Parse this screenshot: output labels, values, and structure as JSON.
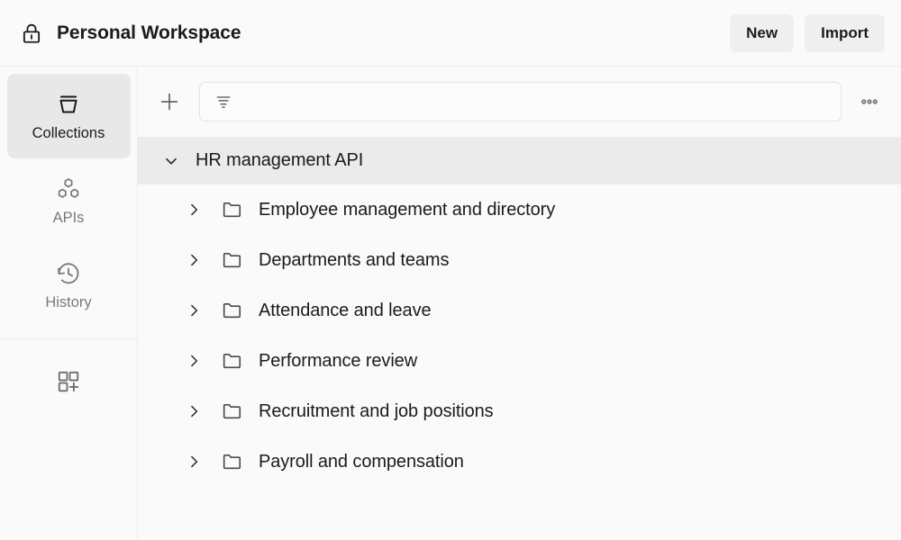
{
  "topbar": {
    "lock_icon": "lock-icon",
    "workspace_title": "Personal Workspace",
    "new_label": "New",
    "import_label": "Import"
  },
  "sidebar": {
    "items": [
      {
        "label": "Collections",
        "icon": "collection-bucket-icon",
        "active": true
      },
      {
        "label": "APIs",
        "icon": "hexagons-icon",
        "active": false
      },
      {
        "label": "History",
        "icon": "clock-history-icon",
        "active": false
      }
    ],
    "add_button_icon": "grid-plus-icon"
  },
  "toolbar": {
    "add_icon": "plus-icon",
    "filter_icon": "filter-icon",
    "filter_value": "",
    "filter_placeholder": "",
    "more_icon": "more-horizontal-icon"
  },
  "tree": {
    "collection": {
      "name": "HR management API",
      "expanded": true,
      "chevron_icon": "chevron-down-icon",
      "highlighted": true
    },
    "folders": [
      {
        "name": "Employee management and directory",
        "chevron_icon": "chevron-right-icon",
        "folder_icon": "folder-icon"
      },
      {
        "name": "Departments and teams",
        "chevron_icon": "chevron-right-icon",
        "folder_icon": "folder-icon"
      },
      {
        "name": "Attendance and leave",
        "chevron_icon": "chevron-right-icon",
        "folder_icon": "folder-icon"
      },
      {
        "name": "Performance review",
        "chevron_icon": "chevron-right-icon",
        "folder_icon": "folder-icon"
      },
      {
        "name": "Recruitment and job positions",
        "chevron_icon": "chevron-right-icon",
        "folder_icon": "folder-icon"
      },
      {
        "name": "Payroll and compensation",
        "chevron_icon": "chevron-right-icon",
        "folder_icon": "folder-icon"
      }
    ]
  },
  "colors": {
    "app_background": "#fafafa",
    "highlight_row": "#ebebeb",
    "rail_active": "#e8e8e8",
    "button_background": "#efefef",
    "text_primary": "#1b1b1b",
    "text_muted": "#7a7a7a",
    "border": "#ededed"
  }
}
